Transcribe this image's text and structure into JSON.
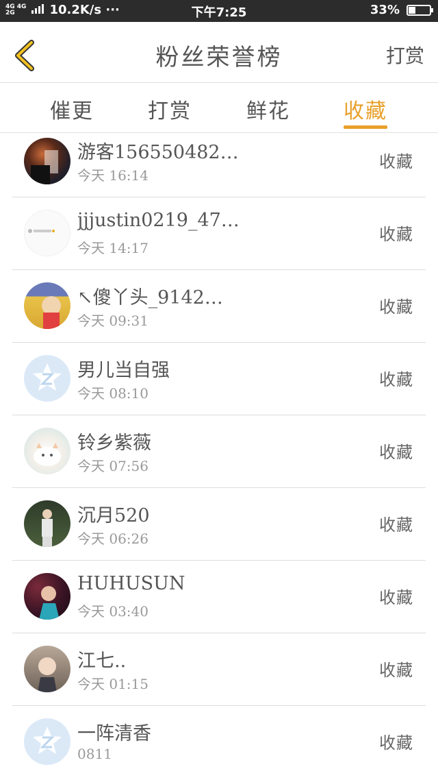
{
  "status_bar": {
    "network": "4G 4G",
    "network2": "2G",
    "speed": "10.2K/s ···",
    "time": "下午7:25",
    "battery_text": "33%",
    "battery_level": 0.33
  },
  "header": {
    "title": "粉丝荣誉榜",
    "action": "打赏",
    "back_icon": "chevron-left-icon",
    "accent_color": "#e8a02a"
  },
  "tabs": [
    {
      "label": "催更",
      "active": false
    },
    {
      "label": "打赏",
      "active": false
    },
    {
      "label": "鲜花",
      "active": false
    },
    {
      "label": "收藏",
      "active": true
    }
  ],
  "rows": [
    {
      "name": "游客156550482…",
      "time": "今天 16:14",
      "badge": "收藏",
      "avatar": "anime-avatar"
    },
    {
      "name": "jjjustin0219_47…",
      "time": "今天 14:17",
      "badge": "收藏",
      "avatar": "white-avatar"
    },
    {
      "name": "↖傻丫头_9142…",
      "time": "今天 09:31",
      "badge": "收藏",
      "avatar": "cartoon-avatar"
    },
    {
      "name": "男儿当自强",
      "time": "今天 08:10",
      "badge": "收藏",
      "avatar": "default-z-avatar"
    },
    {
      "name": "铃乡紫薇",
      "time": "今天 07:56",
      "badge": "收藏",
      "avatar": "cat-avatar"
    },
    {
      "name": "沉月520",
      "time": "今天 06:26",
      "badge": "收藏",
      "avatar": "photo-avatar"
    },
    {
      "name": "HUHUSUN",
      "time": "今天 03:40",
      "badge": "收藏",
      "avatar": "portrait-avatar"
    },
    {
      "name": "江七..",
      "time": "今天 01:15",
      "badge": "收藏",
      "avatar": "girl-avatar"
    },
    {
      "name": "一阵清香",
      "time": "0811",
      "badge": "收藏",
      "avatar": "default-z-avatar"
    }
  ]
}
